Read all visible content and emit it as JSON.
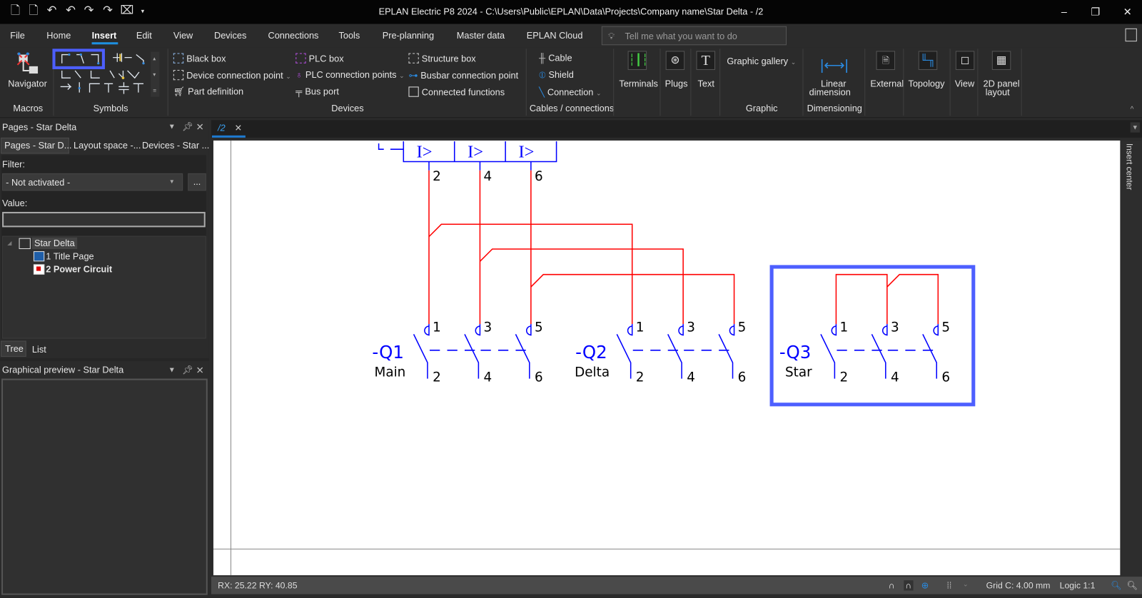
{
  "window": {
    "title": "EPLAN Electric P8 2024 - C:\\Users\\Public\\EPLAN\\Data\\Projects\\Company name\\Star Delta - /2",
    "minimize": "–",
    "restore": "❐",
    "close": "✕"
  },
  "menu": [
    "File",
    "Home",
    "Insert",
    "Edit",
    "View",
    "Devices",
    "Connections",
    "Tools",
    "Pre-planning",
    "Master data",
    "EPLAN Cloud"
  ],
  "search": {
    "placeholder": "Tell me what you want to do"
  },
  "ribbon": {
    "navigator": "Navigator",
    "groups": {
      "macros": "Macros",
      "symbols": "Symbols",
      "devices": "Devices",
      "cables": "Cables / connections",
      "graphic": "Graphic",
      "dimensioning": "Dimensioning"
    },
    "devices_col1": [
      "Black box",
      "Device connection point",
      "Part definition"
    ],
    "devices_col2": [
      "PLC box",
      "PLC connection points",
      "Bus port"
    ],
    "devices_col3": [
      "Structure box",
      "Busbar connection point",
      "Connected functions"
    ],
    "cables": [
      "Cable",
      "Shield",
      "Connection"
    ],
    "big": {
      "terminals": "Terminals",
      "plugs": "Plugs",
      "text": "Text",
      "graphic_gallery": "Graphic gallery",
      "linear1": "Linear",
      "linear2": "dimension",
      "external": "External",
      "topology": "Topology",
      "view": "View",
      "panel1": "2D panel",
      "panel2": "layout"
    }
  },
  "pages_panel": {
    "title": "Pages - Star Delta",
    "tabs": [
      "Pages - Star D...",
      "Layout space -...",
      "Devices - Star ..."
    ],
    "filter_label": "Filter:",
    "filter_value": "- Not activated -",
    "more": "...",
    "value_label": "Value:",
    "value": "",
    "tree": {
      "root": "Star Delta",
      "pages": [
        "1 Title Page",
        "2 Power Circuit"
      ]
    },
    "bottom_tabs": [
      "Tree",
      "List"
    ]
  },
  "preview_panel": {
    "title": "Graphical preview - Star Delta"
  },
  "doc_tab": {
    "label": "/2",
    "close": "✕"
  },
  "insert_center": "Insert center",
  "schematic": {
    "trip_labels": [
      "I>",
      "I>",
      "I>"
    ],
    "top_terminals": [
      "2",
      "4",
      "6"
    ],
    "devices": [
      {
        "tag": "-Q1",
        "name": "Main",
        "top": [
          "1",
          "3",
          "5"
        ],
        "bottom": [
          "2",
          "4",
          "6"
        ]
      },
      {
        "tag": "-Q2",
        "name": "Delta",
        "top": [
          "1",
          "3",
          "5"
        ],
        "bottom": [
          "2",
          "4",
          "6"
        ]
      },
      {
        "tag": "-Q3",
        "name": "Star",
        "top": [
          "1",
          "3",
          "5"
        ],
        "bottom": [
          "2",
          "4",
          "6"
        ]
      }
    ],
    "colors": {
      "symbol": "#0000ff",
      "wire": "#ff0000",
      "highlight": "#4d5fff"
    }
  },
  "status": {
    "coords": "RX: 25.22 RY: 40.85",
    "grid": "Grid C: 4.00 mm",
    "logic": "Logic 1:1"
  }
}
